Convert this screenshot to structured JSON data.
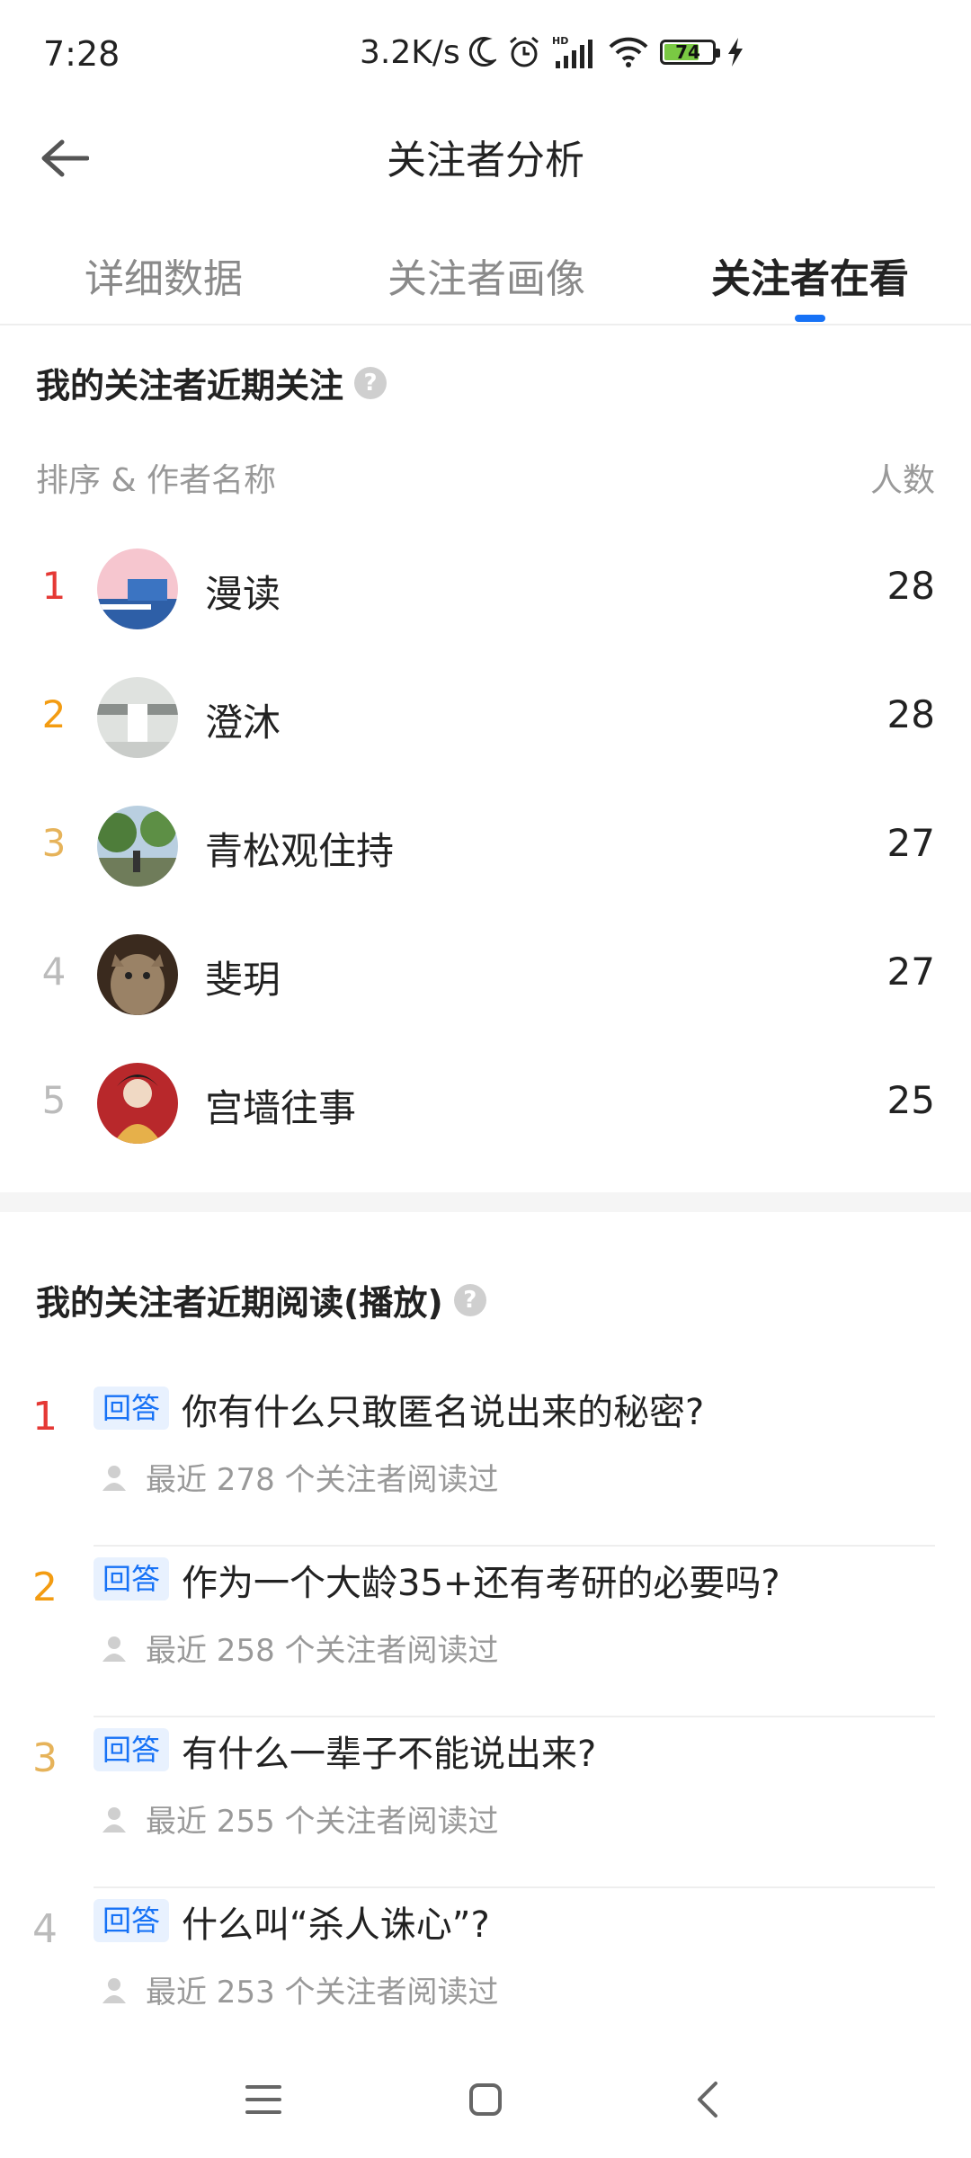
{
  "status_bar": {
    "time": "7:28",
    "net_speed": "3.2K/s",
    "battery_level": "74",
    "icons": [
      "moon-icon",
      "alarm-icon",
      "hd-signal-icon",
      "wifi-icon",
      "battery-icon",
      "charging-bolt-icon"
    ]
  },
  "header": {
    "title": "关注者分析",
    "back_icon": "arrow-left-icon"
  },
  "tabs": [
    {
      "label": "详细数据",
      "active": false
    },
    {
      "label": "关注者画像",
      "active": false
    },
    {
      "label": "关注者在看",
      "active": true
    }
  ],
  "section_follow": {
    "title": "我的关注者近期关注",
    "col_rank_name": "排序 & 作者名称",
    "col_count": "人数",
    "authors": [
      {
        "rank": "1",
        "name": "漫读",
        "count": "28",
        "rank_color": "#e53935"
      },
      {
        "rank": "2",
        "name": "澄沐",
        "count": "28",
        "rank_color": "#f39c12"
      },
      {
        "rank": "3",
        "name": "青松观住持",
        "count": "27",
        "rank_color": "#e6b35a"
      },
      {
        "rank": "4",
        "name": "斐玥",
        "count": "27",
        "rank_color": "#bbbbbb"
      },
      {
        "rank": "5",
        "name": "宫墙往事",
        "count": "25",
        "rank_color": "#bbbbbb"
      }
    ]
  },
  "section_read": {
    "title": "我的关注者近期阅读(播放)",
    "items": [
      {
        "rank": "1",
        "tag": "回答",
        "title": "你有什么只敢匿名说出来的秘密?",
        "meta": "最近 278 个关注者阅读过",
        "rank_color": "#e53935"
      },
      {
        "rank": "2",
        "tag": "回答",
        "title": "作为一个大龄35+还有考研的必要吗?",
        "meta": "最近 258 个关注者阅读过",
        "rank_color": "#f39c12"
      },
      {
        "rank": "3",
        "tag": "回答",
        "title": "有什么一辈子不能说出来?",
        "meta": "最近 255 个关注者阅读过",
        "rank_color": "#e6b35a"
      },
      {
        "rank": "4",
        "tag": "回答",
        "title": "什么叫“杀人诛心”?",
        "meta": "最近 253 个关注者阅读过",
        "rank_color": "#bbbbbb"
      }
    ]
  },
  "colors": {
    "accent": "#1772f6",
    "tag_bg": "#e8f1fe",
    "muted": "#999999"
  },
  "nav_bar": {
    "icons": [
      "menu-icon",
      "home-square-icon",
      "back-chevron-icon"
    ]
  }
}
